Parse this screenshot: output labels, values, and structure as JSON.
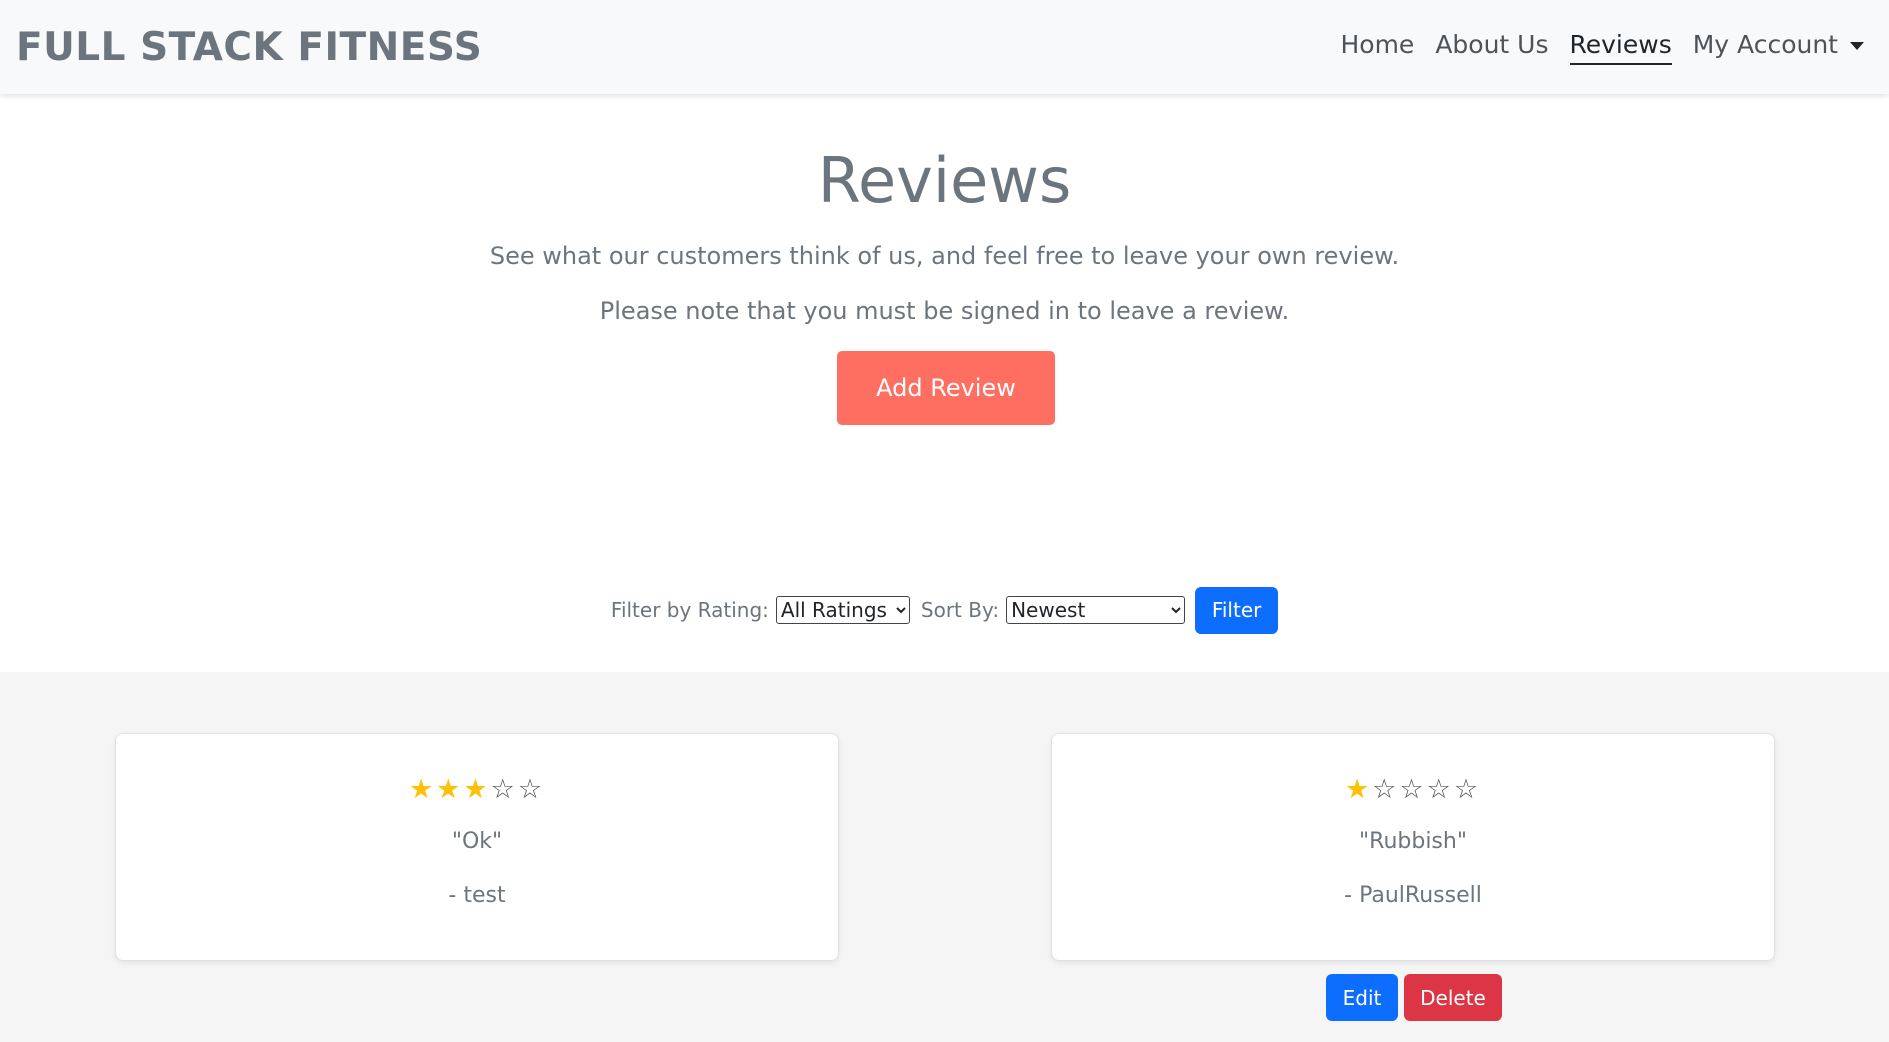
{
  "navbar": {
    "brand": "FULL STACK FITNESS",
    "links": [
      "Home",
      "About Us",
      "Reviews",
      "My Account"
    ],
    "active": "Reviews"
  },
  "hero": {
    "title": "Reviews",
    "subtitle": "See what our customers think of us, and feel free to leave your own review.",
    "note": "Please note that you must be signed in to leave a review.",
    "add_button": "Add Review"
  },
  "filters": {
    "rating_label": "Filter by Rating:",
    "rating_selected": "All Ratings",
    "sort_label": "Sort By:",
    "sort_selected": "Newest",
    "filter_button": "Filter"
  },
  "reviews": [
    {
      "rating": 3,
      "max": 5,
      "comment": "\"Ok\"",
      "author": "- test"
    },
    {
      "rating": 1,
      "max": 5,
      "comment": "\"Rubbish\"",
      "author": "- PaulRussell"
    }
  ],
  "actions": {
    "edit": "Edit",
    "delete": "Delete"
  },
  "colors": {
    "accent": "#ff6f61",
    "primary": "#0d6efd",
    "danger": "#dc3545",
    "star_filled": "#ffc107"
  },
  "icons": {
    "filled_star": "star-filled-icon",
    "empty_star": "star-outline-icon",
    "dropdown_caret": "caret-down-icon"
  }
}
